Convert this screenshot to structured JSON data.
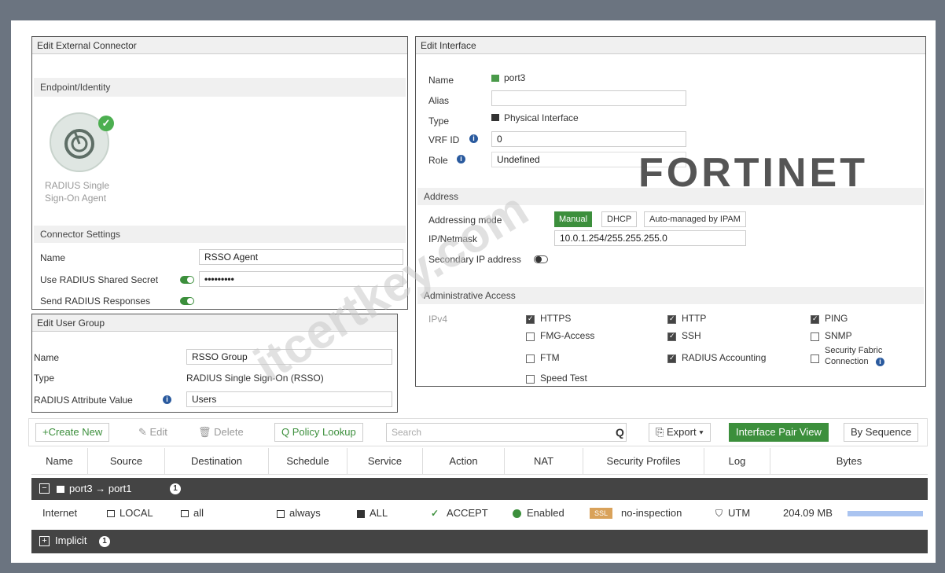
{
  "external_connector": {
    "title": "Edit External Connector",
    "section_endpoint": "Endpoint/Identity",
    "agent_label_line1": "RADIUS Single",
    "agent_label_line2": "Sign-On Agent",
    "section_settings": "Connector Settings",
    "name_label": "Name",
    "name_value": "RSSO Agent",
    "secret_label": "Use RADIUS Shared Secret",
    "secret_value": "•••••••••",
    "send_label": "Send RADIUS Responses"
  },
  "user_group": {
    "title": "Edit User Group",
    "name_label": "Name",
    "name_value": "RSSO Group",
    "type_label": "Type",
    "type_value": "RADIUS Single Sign-On (RSSO)",
    "attr_label": "RADIUS Attribute Value",
    "attr_value": "Users"
  },
  "interface": {
    "title": "Edit Interface",
    "name_label": "Name",
    "name_value": "port3",
    "alias_label": "Alias",
    "type_label": "Type",
    "type_value": "Physical Interface",
    "vrf_label": "VRF ID",
    "vrf_value": "0",
    "role_label": "Role",
    "role_value": "Undefined",
    "address_section": "Address",
    "mode_label": "Addressing mode",
    "mode_options": [
      "Manual",
      "DHCP",
      "Auto-managed by IPAM"
    ],
    "ip_label": "IP/Netmask",
    "ip_value": "10.0.1.254/255.255.255.0",
    "secondary_label": "Secondary IP address",
    "admin_section": "Administrative Access",
    "ipv4_label": "IPv4",
    "access": {
      "https": "HTTPS",
      "http": "HTTP",
      "ping": "PING",
      "fmg": "FMG-Access",
      "ssh": "SSH",
      "snmp": "SNMP",
      "ftm": "FTM",
      "radius_acct": "RADIUS Accounting",
      "fabric_1": "Security Fabric",
      "fabric_2": "Connection",
      "speed": "Speed Test"
    }
  },
  "brand": "FORTINET",
  "watermark": "itcertkey.com",
  "toolbar": {
    "create": "Create New",
    "edit": "Edit",
    "delete": "Delete",
    "policy_lookup": "Policy Lookup",
    "search_placeholder": "Search",
    "export": "Export",
    "pair_view": "Interface Pair View",
    "by_sequence": "By Sequence"
  },
  "table": {
    "headers": [
      "Name",
      "Source",
      "Destination",
      "Schedule",
      "Service",
      "Action",
      "NAT",
      "Security Profiles",
      "Log",
      "Bytes"
    ],
    "group1": {
      "label": "port3 → port1",
      "count": "1"
    },
    "row": {
      "name": "Internet",
      "source": "LOCAL",
      "destination": "all",
      "schedule": "always",
      "service": "ALL",
      "action": "ACCEPT",
      "nat": "Enabled",
      "ssl_badge": "SSL",
      "profile": "no-inspection",
      "log": "UTM",
      "bytes": "204.09 MB"
    },
    "group2": {
      "label": "Implicit",
      "count": "1"
    }
  },
  "colors": {
    "accent_green": "#3c8f3c",
    "dark_row": "#444444",
    "blue_bar": "#aac4f0"
  }
}
